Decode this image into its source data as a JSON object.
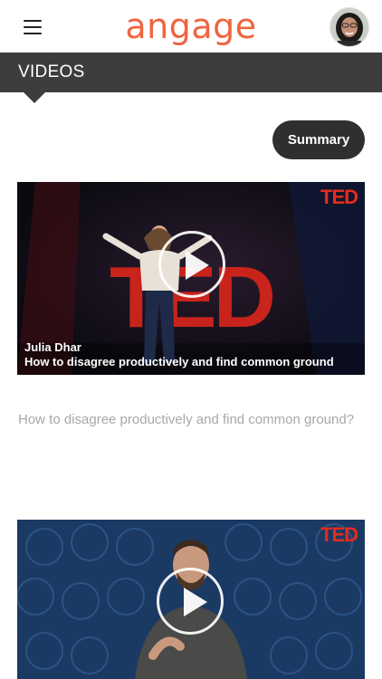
{
  "header": {
    "logo_text": "angage",
    "menu_icon": "hamburger-menu-icon",
    "avatar_icon": "user-avatar"
  },
  "section": {
    "title": "VIDEOS"
  },
  "actions": {
    "summary_label": "Summary"
  },
  "videos": [
    {
      "badge": "TED",
      "speaker": "Julia Dhar",
      "title": "How to disagree productively and find common ground",
      "description": "How to disagree productively and find common ground?"
    },
    {
      "badge": "TED"
    }
  ],
  "colors": {
    "brand": "#ef6441",
    "section_bar": "#3d3d3d",
    "ted_red": "#e62b1e",
    "description_text": "#a8a8a8"
  }
}
